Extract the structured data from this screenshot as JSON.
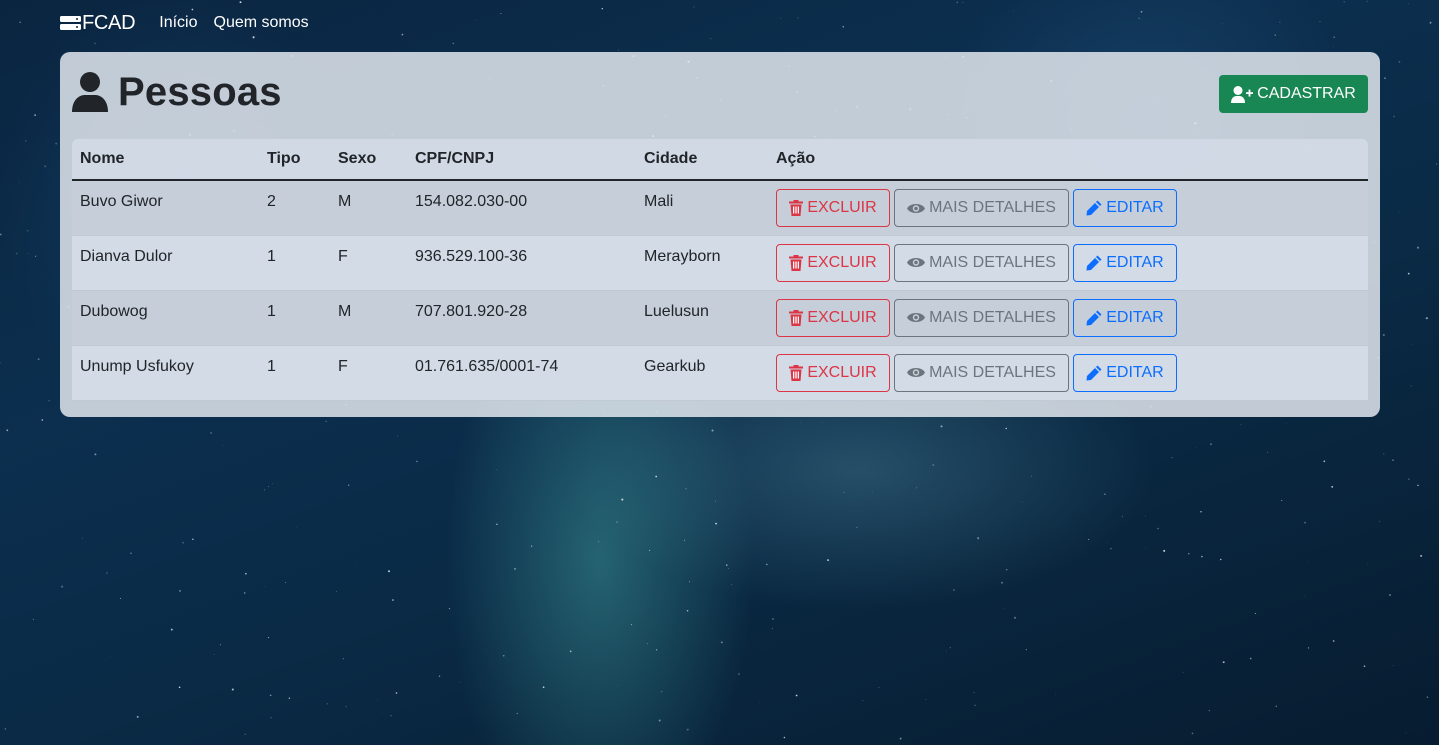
{
  "navbar": {
    "brand": "FCAD",
    "links": [
      "Início",
      "Quem somos"
    ]
  },
  "page": {
    "title": "Pessoas",
    "add_button_label": "CADASTRAR"
  },
  "table": {
    "headers": [
      "Nome",
      "Tipo",
      "Sexo",
      "CPF/CNPJ",
      "Cidade",
      "Ação"
    ],
    "rows": [
      {
        "nome": "Buvo Giwor",
        "tipo": "2",
        "sexo": "M",
        "doc": "154.082.030-00",
        "cidade": "Mali"
      },
      {
        "nome": "Dianva Dulor",
        "tipo": "1",
        "sexo": "F",
        "doc": "936.529.100-36",
        "cidade": "Merayborn"
      },
      {
        "nome": "Dubowog",
        "tipo": "1",
        "sexo": "M",
        "doc": "707.801.920-28",
        "cidade": "Luelusun"
      },
      {
        "nome": "Unump Usfukoy",
        "tipo": "1",
        "sexo": "F",
        "doc": "01.761.635/0001-74",
        "cidade": "Gearkub"
      }
    ],
    "actions": {
      "delete_label": "EXCLUIR",
      "details_label": "MAIS DETALHES",
      "edit_label": "EDITAR"
    }
  },
  "colors": {
    "success": "#198754",
    "danger": "#dc3545",
    "secondary": "#6c757d",
    "primary": "#0d6efd"
  },
  "icons": {
    "brand": "server-icon",
    "title": "user-icon",
    "add": "user-plus-icon",
    "delete": "trash-icon",
    "details": "eye-icon",
    "edit": "pencil-icon"
  }
}
